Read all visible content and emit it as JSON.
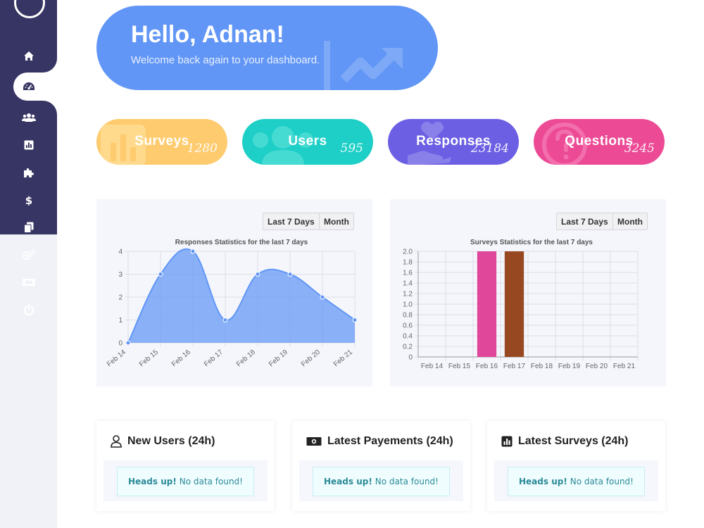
{
  "sidebar": {
    "items": [
      {
        "icon": "home-icon"
      },
      {
        "icon": "dashboard-icon",
        "active": true
      },
      {
        "icon": "users-icon"
      },
      {
        "icon": "chart-icon"
      },
      {
        "icon": "puzzle-icon"
      },
      {
        "icon": "dollar-icon"
      },
      {
        "icon": "copy-icon"
      },
      {
        "icon": "cogs-icon"
      },
      {
        "icon": "ticket-icon"
      },
      {
        "icon": "power-icon"
      }
    ]
  },
  "hero": {
    "title": "Hello, Adnan!",
    "subtitle": "Welcome back again to your dashboard."
  },
  "stats": [
    {
      "label": "Surveys",
      "value": "1280",
      "color": "#fecb6e"
    },
    {
      "label": "Users",
      "value": "595",
      "color": "#1dcfc6"
    },
    {
      "label": "Responses",
      "value": "23184",
      "color": "#6c5fe3"
    },
    {
      "label": "Questions",
      "value": "3245",
      "color": "#ec4a95"
    }
  ],
  "range_buttons": {
    "week": "Last 7 Days",
    "month": "Month"
  },
  "chart_data": [
    {
      "type": "area",
      "title": "Responses Statistics for the last 7 days",
      "categories": [
        "Feb 14",
        "Feb 15",
        "Feb 16",
        "Feb 17",
        "Feb 18",
        "Feb 19",
        "Feb 20",
        "Feb 21"
      ],
      "values": [
        0,
        3,
        4,
        1,
        3,
        3,
        2,
        1
      ],
      "ylim": [
        0,
        4
      ],
      "yticks": [
        "0",
        "1",
        "2",
        "3",
        "4"
      ],
      "grid": true,
      "color": "#6196f6"
    },
    {
      "type": "bar",
      "title": "Surveys Statistics for the last 7 days",
      "categories": [
        "Feb 14",
        "Feb 15",
        "Feb 16",
        "Feb 17",
        "Feb 18",
        "Feb 19",
        "Feb 20",
        "Feb 21"
      ],
      "values": [
        0,
        0,
        2,
        2,
        0,
        0,
        0,
        0
      ],
      "bar_colors": [
        "#e0479a",
        "#e0479a",
        "#e0479a",
        "#984821",
        "#e0479a",
        "#e0479a",
        "#e0479a",
        "#e0479a"
      ],
      "ylim": [
        0,
        2
      ],
      "yticks": [
        "0",
        "0.2",
        "0.4",
        "0.6",
        "0.8",
        "1.0",
        "1.2",
        "1.4",
        "1.6",
        "1.8",
        "2.0"
      ],
      "grid": true
    }
  ],
  "cards": [
    {
      "title": "New Users (24h)",
      "icon": "user-icon",
      "alert_strong": "Heads up!",
      "alert_text": "No data found!"
    },
    {
      "title": "Latest Payements (24h)",
      "icon": "money-icon",
      "alert_strong": "Heads up!",
      "alert_text": "No data found!"
    },
    {
      "title": "Latest Surveys (24h)",
      "icon": "chart-square-icon",
      "alert_strong": "Heads up!",
      "alert_text": "No data found!"
    }
  ]
}
